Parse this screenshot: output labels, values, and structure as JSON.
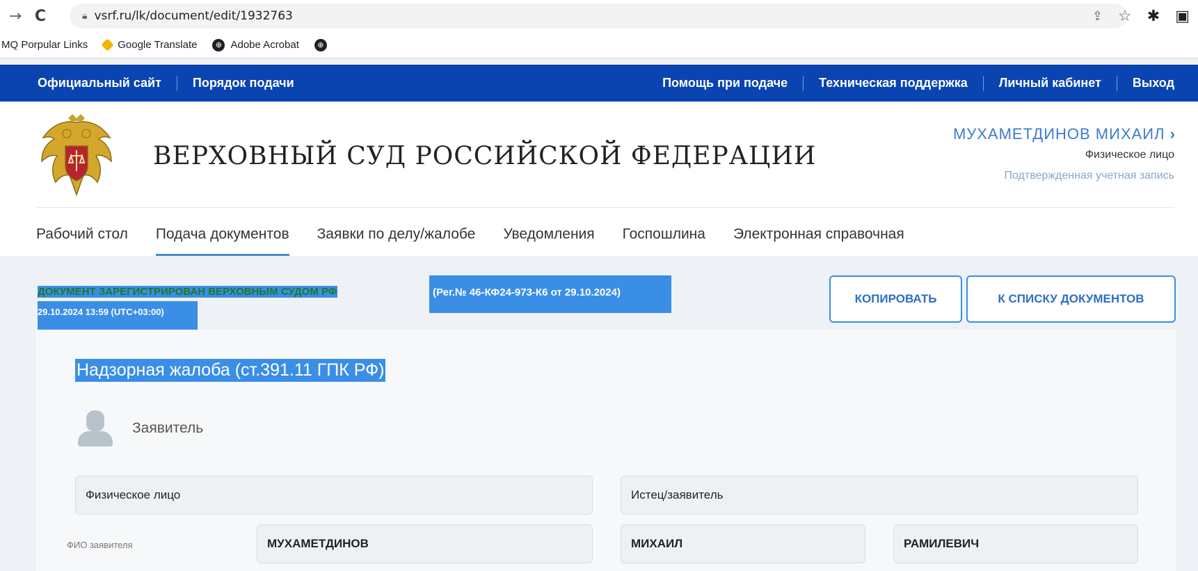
{
  "browser": {
    "url": "vsrf.ru/lk/document/edit/1932763",
    "bookmarks": [
      "MQ Porpular Links",
      "Google Translate",
      "Adobe Acrobat"
    ]
  },
  "topnav": {
    "left": [
      "Официальный сайт",
      "Порядок подачи"
    ],
    "right": [
      "Помощь при подаче",
      "Техническая поддержка",
      "Личный кабинет",
      "Выход"
    ]
  },
  "header": {
    "title": "ВЕРХОВНЫЙ СУД РОССИЙСКОЙ ФЕДЕРАЦИИ",
    "user_name": "МУХАМЕТДИНОВ МИХАИЛ",
    "user_type": "Физическое лицо",
    "user_status": "Подтвержденная учетная запись"
  },
  "menu": {
    "items": [
      "Рабочий стол",
      "Подача документов",
      "Заявки по делу/жалобе",
      "Уведомления",
      "Госпошлина",
      "Электронная справочная"
    ],
    "active_index": 1
  },
  "status": {
    "registered_part1": "ДОКУМЕНТ ЗАРЕГИСТРИРОВАН ВЕРХОВНЫМ СУДОМ РФ",
    "registered_datetime": "29.10.2024 13:59 (UTC+03:00)",
    "reg_number": "(Рег.№ 46-КФ24-973-К6 от 29.10.2024)"
  },
  "buttons": {
    "copy": "КОПИРОВАТЬ",
    "to_list": "К СПИСКУ ДОКУМЕНТОВ"
  },
  "document": {
    "title": "Надзорная жалоба (ст.391.11 ГПК РФ)",
    "applicant_label": "Заявитель",
    "person_type": "Физическое лицо",
    "role": "Истец/заявитель",
    "fio_label": "ФИО заявителя",
    "last_name": "МУХАМЕТДИНОВ",
    "first_name": "МИХАИЛ",
    "middle_name": "РАМИЛЕВИЧ"
  },
  "colors": {
    "nav_bg": "#0a44b0",
    "accent": "#3a8ee6",
    "success": "#1c7a26"
  }
}
